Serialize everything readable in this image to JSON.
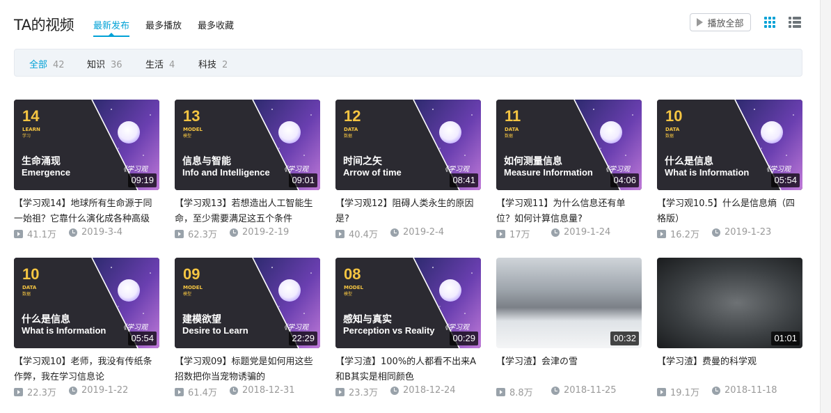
{
  "header": {
    "title": "TA的视频",
    "sort_tabs": [
      {
        "label": "最新发布",
        "active": true
      },
      {
        "label": "最多播放",
        "active": false
      },
      {
        "label": "最多收藏",
        "active": false
      }
    ],
    "play_all_label": "播放全部",
    "view_modes": [
      "grid-icon",
      "list-icon"
    ],
    "active_view": "grid"
  },
  "filters": [
    {
      "label": "全部",
      "count": "42",
      "active": true
    },
    {
      "label": "知识",
      "count": "36",
      "active": false
    },
    {
      "label": "生活",
      "count": "4",
      "active": false
    },
    {
      "label": "科技",
      "count": "2",
      "active": false
    }
  ],
  "colors": {
    "accent": "#00a1d6",
    "meta_text": "#999999",
    "thumb_dark": "#2b2a31",
    "thumb_gold": "#f5c542",
    "thumb_purple": "#5b3aa8"
  },
  "videos": [
    {
      "num": "14",
      "en_tag": "LEARN",
      "cn_tag": "学习",
      "thumb_cn": "生命涌现",
      "thumb_en": "Emergence",
      "brand": "《学习观",
      "duration": "09:19",
      "title": "【学习观14】地球所有生命源于同一始祖？它靠什么演化成各种高级",
      "plays": "41.1万",
      "date": "2019-3-4"
    },
    {
      "num": "13",
      "en_tag": "MODEL",
      "cn_tag": "模型",
      "thumb_cn": "信息与智能",
      "thumb_en": "Info and Intelligence",
      "brand": "《学习观",
      "duration": "09:01",
      "title": "【学习观13】若想造出人工智能生命，至少需要满足这五个条件",
      "plays": "62.3万",
      "date": "2019-2-19"
    },
    {
      "num": "12",
      "en_tag": "DATA",
      "cn_tag": "数据",
      "thumb_cn": "时间之矢",
      "thumb_en": "Arrow of time",
      "brand": "《学习观",
      "duration": "08:41",
      "title": "【学习观12】阻碍人类永生的原因是?",
      "plays": "40.4万",
      "date": "2019-2-4"
    },
    {
      "num": "11",
      "en_tag": "DATA",
      "cn_tag": "数据",
      "thumb_cn": "如何测量信息",
      "thumb_en": "Measure Information",
      "brand": "《学习观",
      "duration": "04:06",
      "title": "【学习观11】为什么信息还有单位？如何计算信息量?",
      "plays": "17万",
      "date": "2019-1-24"
    },
    {
      "num": "10",
      "en_tag": "DATA",
      "cn_tag": "数据",
      "thumb_cn": "什么是信息",
      "thumb_en": "What is Information",
      "brand": "《学习观",
      "duration": "05:54",
      "title": "【学习观10.5】什么是信息熵（四格版）",
      "plays": "16.2万",
      "date": "2019-1-23"
    },
    {
      "num": "10",
      "en_tag": "DATA",
      "cn_tag": "数据",
      "thumb_cn": "什么是信息",
      "thumb_en": "What is Information",
      "brand": "《学习观",
      "duration": "05:54",
      "title": "【学习观10】老师，我没有传纸条作弊，我在学习信息论",
      "plays": "22.3万",
      "date": "2019-1-22"
    },
    {
      "num": "09",
      "en_tag": "MODEL",
      "cn_tag": "模型",
      "thumb_cn": "建模欲望",
      "thumb_en": "Desire to Learn",
      "brand": "《学习观",
      "duration": "22:29",
      "title": "【学习观09】标题党是如何用这些招数把你当宠物诱骗的",
      "plays": "61.4万",
      "date": "2018-12-31"
    },
    {
      "num": "08",
      "en_tag": "MODEL",
      "cn_tag": "模型",
      "thumb_cn": "感知与真实",
      "thumb_en": "Perception vs Reality",
      "brand": "《学习观",
      "duration": "00:29",
      "title": "【学习渣】100%的人都看不出来A和B其实是相同颜色",
      "plays": "23.3万",
      "date": "2018-12-24"
    },
    {
      "num": "",
      "en_tag": "",
      "cn_tag": "",
      "thumb_cn": "",
      "thumb_en": "",
      "brand": "",
      "duration": "00:32",
      "title": "【学习渣】会津の雪",
      "plays": "8.8万",
      "date": "2018-11-25"
    },
    {
      "num": "",
      "en_tag": "",
      "cn_tag": "",
      "thumb_cn": "",
      "thumb_en": "",
      "brand": "",
      "duration": "01:01",
      "title": "【学习渣】费曼的科学观",
      "plays": "19.1万",
      "date": "2018-11-18"
    }
  ]
}
